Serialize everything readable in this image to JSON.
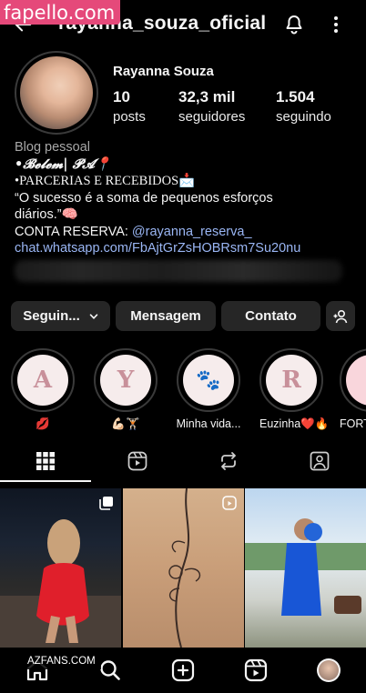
{
  "watermark_top": "fapello.com",
  "watermark_bottom": "AZFANS.COM",
  "header": {
    "username": "rayanna_souza_oficial",
    "icons": [
      "back-arrow-icon",
      "bell-icon",
      "more-options-icon"
    ]
  },
  "profile": {
    "display_name": "Rayanna Souza",
    "stats": [
      {
        "value": "10",
        "label": "posts"
      },
      {
        "value": "32,3 mil",
        "label": "seguidores"
      },
      {
        "value": "1.504",
        "label": "seguindo"
      }
    ]
  },
  "bio": {
    "category": "Blog pessoal",
    "line1": "•𝓑𝓮𝓵𝓮𝓶| 𝓟𝓐📍",
    "line2": "•PARCERIAS E RECEBIDOS📩",
    "line3": "“O sucesso é a soma de pequenos esforços",
    "line4": "diários.”🧠",
    "line5_prefix": "CONTA RESERVA: ",
    "line5_link": "@rayanna_reserva_",
    "link": "chat.whatsapp.com/FbAjtGrZsHOBRsm7Su20nu"
  },
  "buttons": {
    "following": "Seguin...",
    "message": "Mensagem",
    "contact": "Contato"
  },
  "highlights": [
    {
      "letter": "A",
      "label": "💋"
    },
    {
      "letter": "Y",
      "label": "💪🏻🏋🏻"
    },
    {
      "letter": "🐾",
      "label": "Minha vida..."
    },
    {
      "letter": "R",
      "label": "Euzinha❤️🔥"
    },
    {
      "letter": "",
      "label": "FORT"
    }
  ],
  "tabs": [
    "grid-icon",
    "reels-icon",
    "reposts-icon",
    "tagged-icon"
  ],
  "bottom_nav": [
    "home-icon",
    "search-icon",
    "create-icon",
    "reels-icon",
    "profile-icon"
  ],
  "colors": {
    "background": "#000000",
    "button": "#262626",
    "link": "#9ab6f4",
    "watermark": "#e5497a"
  }
}
